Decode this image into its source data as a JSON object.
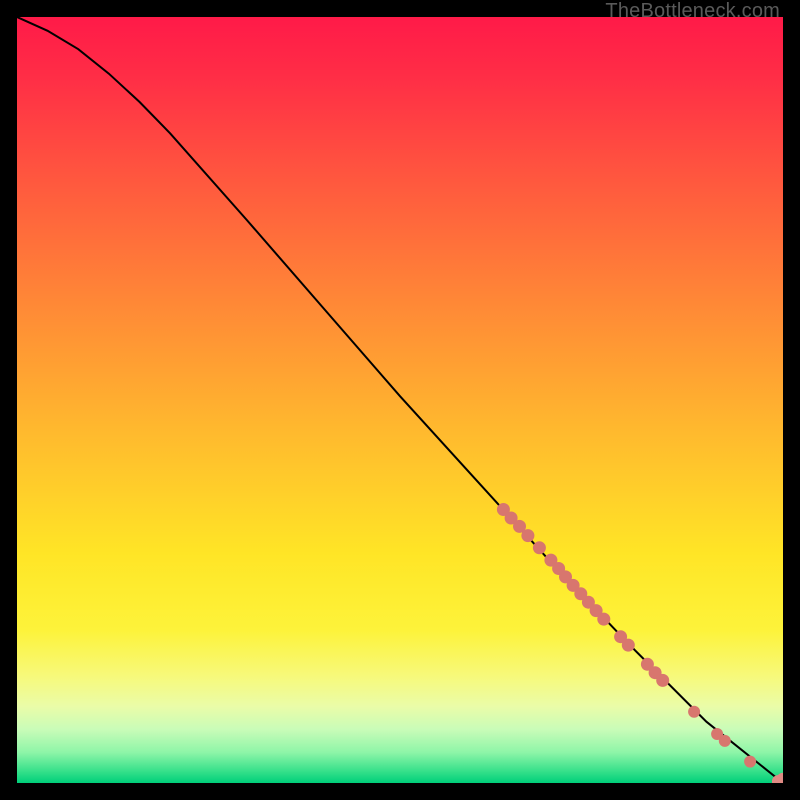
{
  "watermark": "TheBottleneck.com",
  "colors": {
    "curve_stroke": "#000000",
    "marker_fill": "#d8766e",
    "marker_fill_end": "#e08a84",
    "frame_bg_stops": [
      "#ff1a48",
      "#ff2e46",
      "#ff5a3e",
      "#ff8a36",
      "#ffb92e",
      "#ffe526",
      "#fdf33a",
      "#f7f97a",
      "#eafca8",
      "#c9fcb8",
      "#8ef5a8",
      "#35e08a",
      "#00cf7a"
    ]
  },
  "chart_data": {
    "type": "line",
    "title": "",
    "xlabel": "",
    "ylabel": "",
    "xlim": [
      0,
      100
    ],
    "ylim": [
      0,
      100
    ],
    "grid": false,
    "legend": false,
    "curve": [
      {
        "x": 0,
        "y": 100
      },
      {
        "x": 4,
        "y": 98.2
      },
      {
        "x": 8,
        "y": 95.8
      },
      {
        "x": 12,
        "y": 92.6
      },
      {
        "x": 16,
        "y": 88.9
      },
      {
        "x": 20,
        "y": 84.8
      },
      {
        "x": 30,
        "y": 73.5
      },
      {
        "x": 40,
        "y": 62.0
      },
      {
        "x": 50,
        "y": 50.5
      },
      {
        "x": 60,
        "y": 39.5
      },
      {
        "x": 70,
        "y": 28.5
      },
      {
        "x": 80,
        "y": 18.0
      },
      {
        "x": 90,
        "y": 8.0
      },
      {
        "x": 100,
        "y": 0.0
      }
    ],
    "markers": [
      {
        "x": 63.5,
        "y": 35.7,
        "r": 6.5
      },
      {
        "x": 64.5,
        "y": 34.6,
        "r": 6.5
      },
      {
        "x": 65.6,
        "y": 33.5,
        "r": 6.5
      },
      {
        "x": 66.7,
        "y": 32.3,
        "r": 6.5
      },
      {
        "x": 68.2,
        "y": 30.7,
        "r": 6.5
      },
      {
        "x": 69.7,
        "y": 29.1,
        "r": 6.5
      },
      {
        "x": 70.7,
        "y": 28.0,
        "r": 6.5
      },
      {
        "x": 71.6,
        "y": 26.9,
        "r": 6.5
      },
      {
        "x": 72.6,
        "y": 25.8,
        "r": 6.5
      },
      {
        "x": 73.6,
        "y": 24.7,
        "r": 6.5
      },
      {
        "x": 74.6,
        "y": 23.6,
        "r": 6.5
      },
      {
        "x": 75.6,
        "y": 22.5,
        "r": 6.5
      },
      {
        "x": 76.6,
        "y": 21.4,
        "r": 6.5
      },
      {
        "x": 78.8,
        "y": 19.1,
        "r": 6.5
      },
      {
        "x": 79.8,
        "y": 18.0,
        "r": 6.5
      },
      {
        "x": 82.3,
        "y": 15.5,
        "r": 6.5
      },
      {
        "x": 83.3,
        "y": 14.4,
        "r": 6.5
      },
      {
        "x": 84.3,
        "y": 13.4,
        "r": 6.5
      },
      {
        "x": 88.4,
        "y": 9.3,
        "r": 6.0
      },
      {
        "x": 91.4,
        "y": 6.4,
        "r": 6.0
      },
      {
        "x": 92.4,
        "y": 5.5,
        "r": 6.0
      },
      {
        "x": 95.7,
        "y": 2.8,
        "r": 6.0
      },
      {
        "x": 99.4,
        "y": 0.2,
        "r": 6.5
      },
      {
        "x": 100.0,
        "y": 0.5,
        "r": 6.5
      }
    ]
  }
}
